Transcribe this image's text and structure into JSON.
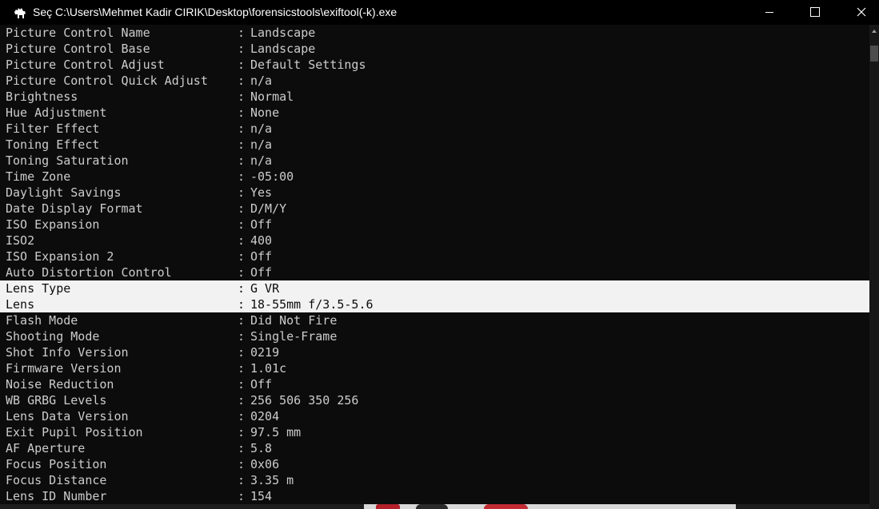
{
  "window": {
    "title": "Seç C:\\Users\\Mehmet Kadir CIRIK\\Desktop\\forensicstools\\exiftool(-k).exe",
    "icon": "camel-icon",
    "controls": [
      "minimize-icon",
      "maximize-icon",
      "close-icon"
    ]
  },
  "console": {
    "separator": ":",
    "selected_rows": [
      16,
      17
    ],
    "rows": [
      {
        "key": "Picture Control Name",
        "value": "Landscape"
      },
      {
        "key": "Picture Control Base",
        "value": "Landscape"
      },
      {
        "key": "Picture Control Adjust",
        "value": "Default Settings"
      },
      {
        "key": "Picture Control Quick Adjust",
        "value": "n/a"
      },
      {
        "key": "Brightness",
        "value": "Normal"
      },
      {
        "key": "Hue Adjustment",
        "value": "None"
      },
      {
        "key": "Filter Effect",
        "value": "n/a"
      },
      {
        "key": "Toning Effect",
        "value": "n/a"
      },
      {
        "key": "Toning Saturation",
        "value": "n/a"
      },
      {
        "key": "Time Zone",
        "value": "-05:00"
      },
      {
        "key": "Daylight Savings",
        "value": "Yes"
      },
      {
        "key": "Date Display Format",
        "value": "D/M/Y"
      },
      {
        "key": "ISO Expansion",
        "value": "Off"
      },
      {
        "key": "ISO2",
        "value": "400"
      },
      {
        "key": "ISO Expansion 2",
        "value": "Off"
      },
      {
        "key": "Auto Distortion Control",
        "value": "Off"
      },
      {
        "key": "Lens Type",
        "value": "G VR"
      },
      {
        "key": "Lens",
        "value": "18-55mm f/3.5-5.6"
      },
      {
        "key": "Flash Mode",
        "value": "Did Not Fire"
      },
      {
        "key": "Shooting Mode",
        "value": "Single-Frame"
      },
      {
        "key": "Shot Info Version",
        "value": "0219"
      },
      {
        "key": "Firmware Version",
        "value": "1.01c"
      },
      {
        "key": "Noise Reduction",
        "value": "Off"
      },
      {
        "key": "WB GRBG Levels",
        "value": "256 506 350 256"
      },
      {
        "key": "Lens Data Version",
        "value": "0204"
      },
      {
        "key": "Exit Pupil Position",
        "value": "97.5 mm"
      },
      {
        "key": "AF Aperture",
        "value": "5.8"
      },
      {
        "key": "Focus Position",
        "value": "0x06"
      },
      {
        "key": "Focus Distance",
        "value": "3.35 m"
      },
      {
        "key": "Lens ID Number",
        "value": "154"
      }
    ]
  },
  "colors": {
    "console_bg": "#0c0c0c",
    "console_text": "#cccccc",
    "selection_bg": "#f2f2f2",
    "selection_text": "#0c0c0c"
  }
}
